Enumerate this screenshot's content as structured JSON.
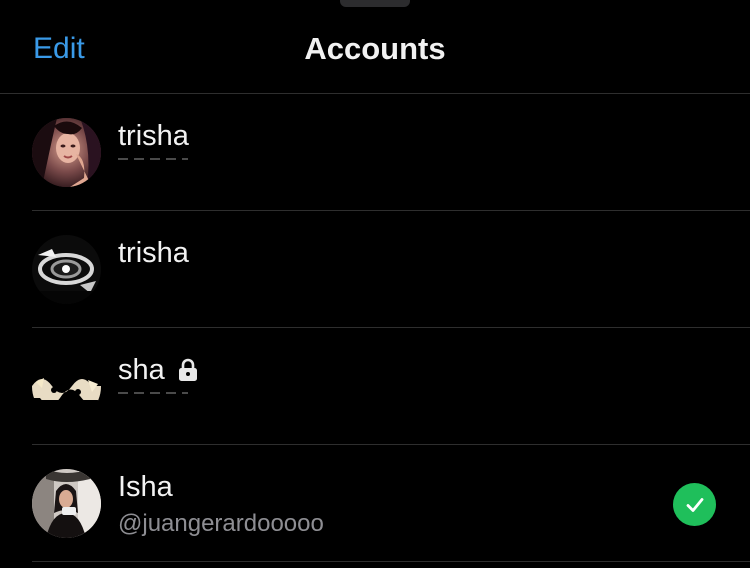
{
  "header": {
    "edit_label": "Edit",
    "title": "Accounts"
  },
  "accounts": [
    {
      "name": "trisha",
      "handle": "",
      "locked": false,
      "selected": false,
      "avatar": "portrait-photo"
    },
    {
      "name": "trisha",
      "handle": "",
      "locked": false,
      "selected": false,
      "avatar": "dark-photo"
    },
    {
      "name": "sha",
      "handle": "",
      "locked": true,
      "selected": false,
      "avatar": "pattern-photo"
    },
    {
      "name": "Isha",
      "handle": "@juangerardooooo",
      "locked": false,
      "selected": true,
      "avatar": "car-selfie-photo"
    }
  ],
  "icons": {
    "lock": "lock-icon",
    "selected": "checkmark-icon"
  },
  "colors": {
    "background": "#000000",
    "accent": "#3a9ae8",
    "selected_badge": "#1fbf5b",
    "secondary_text": "#8e8e93",
    "divider": "#2e2e2e"
  }
}
